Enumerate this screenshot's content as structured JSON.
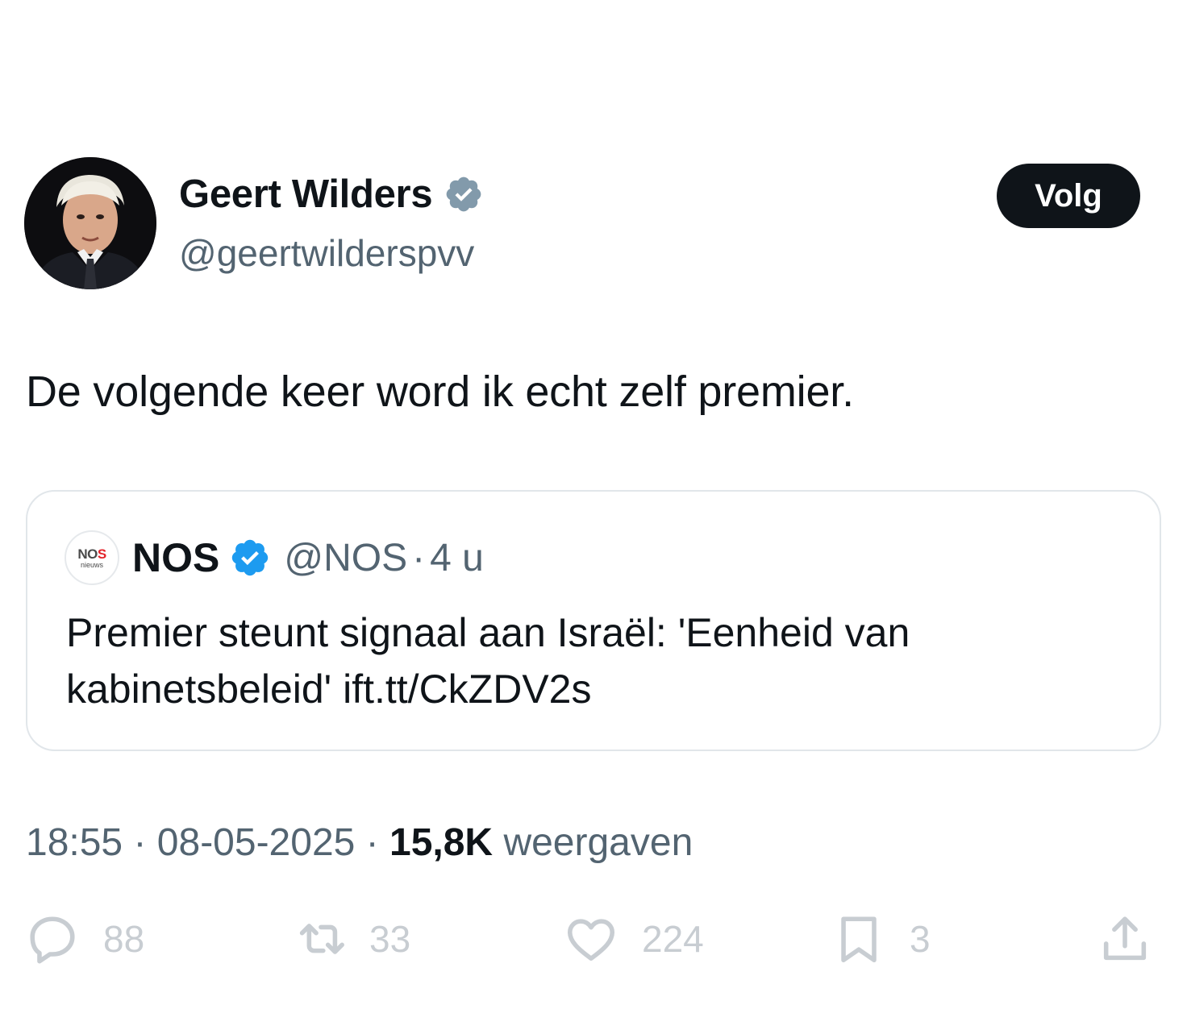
{
  "author": {
    "name": "Geert Wilders",
    "handle": "@geertwilderspvv",
    "verified_color": "#829aab"
  },
  "follow_label": "Volg",
  "tweet_text": "De volgende keer word ik echt zelf premier.",
  "quoted": {
    "logo_text_1a": "NO",
    "logo_text_1b": "S",
    "logo_text_2": "nieuws",
    "name": "NOS",
    "handle": "@NOS",
    "separator": "·",
    "time": "4 u",
    "text": "Premier steunt signaal aan Israël: 'Eenheid van kabinetsbeleid' ift.tt/CkZDV2s",
    "verified_color": "#1d9bf0"
  },
  "meta": {
    "time": "18:55",
    "sep": "·",
    "date": "08-05-2025",
    "views_count": "15,8K",
    "views_label": "weergaven"
  },
  "actions": {
    "replies": "88",
    "reposts": "33",
    "likes": "224",
    "bookmarks": "3"
  }
}
